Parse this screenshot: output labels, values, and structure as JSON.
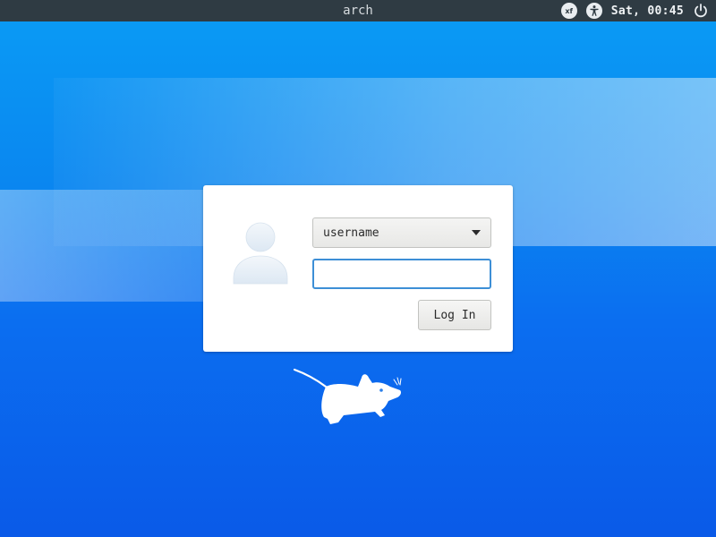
{
  "panel": {
    "hostname": "arch",
    "xfce_icon_text": "xf",
    "clock": "Sat, 00:45"
  },
  "login": {
    "username": "username",
    "password_value": "",
    "login_label": "Log In"
  },
  "colors": {
    "panel_bg": "#2f3b43",
    "accent": "#3d8fd6",
    "background_top": "#0a9cf5",
    "background_bottom": "#0a5ae8"
  },
  "icons": [
    "xfce-icon",
    "accessibility-icon",
    "power-icon",
    "avatar-icon",
    "chevron-down-icon",
    "xfce-mouse-logo-icon"
  ]
}
